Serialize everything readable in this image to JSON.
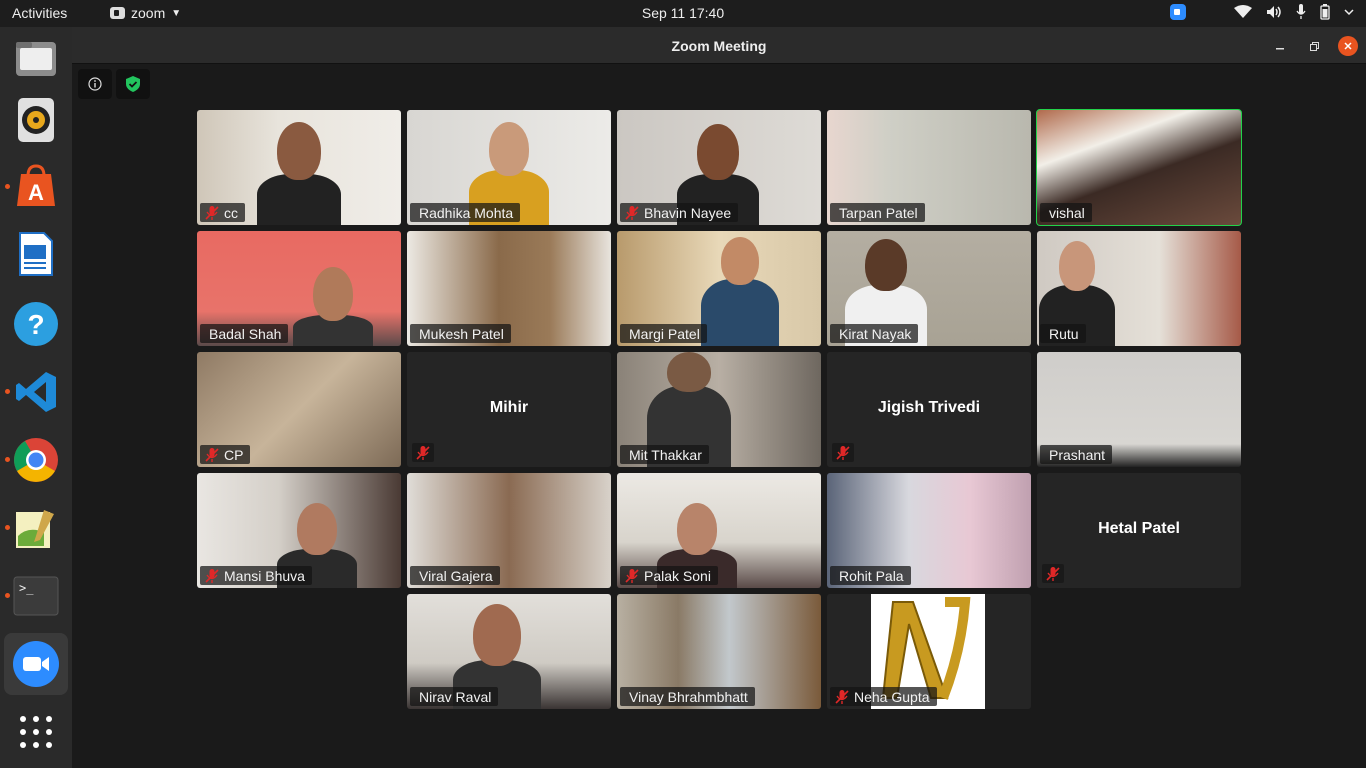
{
  "topbar": {
    "activities": "Activities",
    "app_name": "zoom",
    "datetime": "Sep 11  17:40"
  },
  "window": {
    "title": "Zoom Meeting"
  },
  "participants": [
    {
      "name": "cc",
      "muted": true
    },
    {
      "name": "Radhika Mohta",
      "muted": false
    },
    {
      "name": "Bhavin Nayee",
      "muted": true
    },
    {
      "name": "Tarpan Patel",
      "muted": false
    },
    {
      "name": "vishal",
      "muted": false,
      "speaking": true
    },
    {
      "name": "Badal Shah",
      "muted": false
    },
    {
      "name": "Mukesh Patel",
      "muted": false
    },
    {
      "name": "Margi Patel",
      "muted": false
    },
    {
      "name": "Kirat Nayak",
      "muted": false
    },
    {
      "name": "Rutu",
      "muted": false
    },
    {
      "name": "CP",
      "muted": true
    },
    {
      "name": "Mihir",
      "muted": true,
      "video_off": true
    },
    {
      "name": "Mit Thakkar",
      "muted": false
    },
    {
      "name": "Jigish Trivedi",
      "muted": true,
      "video_off": true
    },
    {
      "name": "Prashant",
      "muted": false
    },
    {
      "name": "Mansi Bhuva",
      "muted": true
    },
    {
      "name": "Viral Gajera",
      "muted": false
    },
    {
      "name": "Palak Soni",
      "muted": true
    },
    {
      "name": "Rohit Pala",
      "muted": false
    },
    {
      "name": "Hetal Patel",
      "muted": true,
      "video_off": true
    },
    {
      "name": "Nirav Raval",
      "muted": false
    },
    {
      "name": "Vinay Bhrahmbhatt",
      "muted": false
    },
    {
      "name": "Neha Gupta",
      "muted": true
    }
  ],
  "colors": {
    "speaking_border": "#22d34a",
    "ubuntu_orange": "#e95420",
    "zoom_blue": "#2d8cff"
  }
}
